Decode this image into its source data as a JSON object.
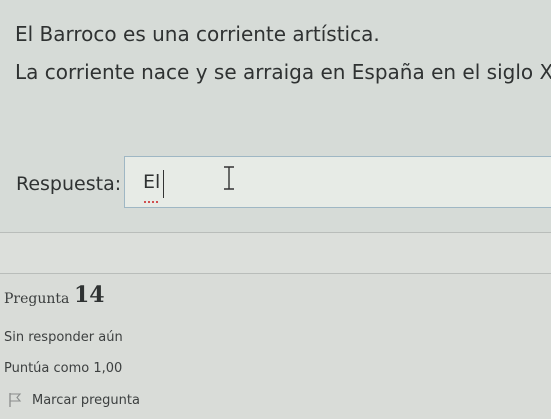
{
  "question": {
    "line1": "El Barroco es una corriente artística.",
    "line2": "La corriente nace y se arraiga en España en el siglo XVI"
  },
  "answer": {
    "label": "Respuesta:",
    "value": "El"
  },
  "question_info": {
    "label": "Pregunta",
    "number": "14",
    "status": "Sin responder aún",
    "score": "Puntúa como 1,00",
    "flag_label": "Marcar pregunta"
  },
  "icons": {
    "flag": "flag-icon",
    "cursor": "text-ibeam-cursor-icon"
  }
}
